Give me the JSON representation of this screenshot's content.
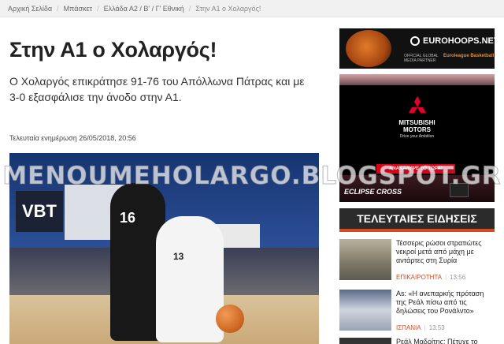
{
  "breadcrumb": {
    "items": [
      "Αρχική Σελίδα",
      "Μπάσκετ",
      "Ελλάδα Α2 / Β' / Γ' Εθνική",
      "Στην Α1 ο Χολαργός!"
    ]
  },
  "article": {
    "title": "Στην Α1 ο Χολαργός!",
    "subtitle": "Ο Χολαργός επικράτησε 91-76 του Απόλλωνα Πάτρας και με 3-0 εξασφάλισε την άνοδο στην Α1.",
    "updated_label": "Τελευταία ενημέρωση",
    "updated_value": "26/05/2018, 20:56",
    "photo": {
      "banner_text": "VBT",
      "player1_number": "16",
      "player2_number": "13"
    }
  },
  "watermark": "MENOUMEHOLARGO.BLOGSPOT.GR",
  "ads": {
    "eurohoops": {
      "brand": "EUROHOOPS.NET",
      "partner": "OFFICIAL GLOBAL MEDIA PARTNER",
      "league": "Euroleague Basketball"
    },
    "mitsubishi": {
      "brand_line1": "MITSUBISHI",
      "brand_line2": "MOTORS",
      "tagline": "Drive your Ambition",
      "cta": "ΑΝΑΚΑΛΥΨΕ ΤΟ ΤΩΡΑ!",
      "model": "ECLIPSE CROSS"
    }
  },
  "sidebar": {
    "news_header": "ΤΕΛΕΥΤΑΙΕΣ ΕΙΔΗΣΕΙΣ",
    "news": [
      {
        "headline": "Τέσσερις ρώσοι στρατιώτες νεκροί μετά από μάχη με αντάρτες στη Συρία",
        "category": "ΕΠΙΚΑΙΡΟΤΗΤΑ",
        "time": "13:56"
      },
      {
        "headline": "As: «Η ανεπαρκής πρόταση της Ρεάλ πίσω από τις δηλώσεις του Ρονάλντο»",
        "category": "ΙΣΠΑΝΙΑ",
        "time": "13:53"
      },
      {
        "headline": "Ρεάλ Μαδρίτης: Πέτυχε το",
        "category": "",
        "time": ""
      }
    ]
  },
  "colors": {
    "accent": "#d64a1f",
    "header_bg": "#2b2b2b",
    "mitsubishi_red": "#d80018"
  }
}
